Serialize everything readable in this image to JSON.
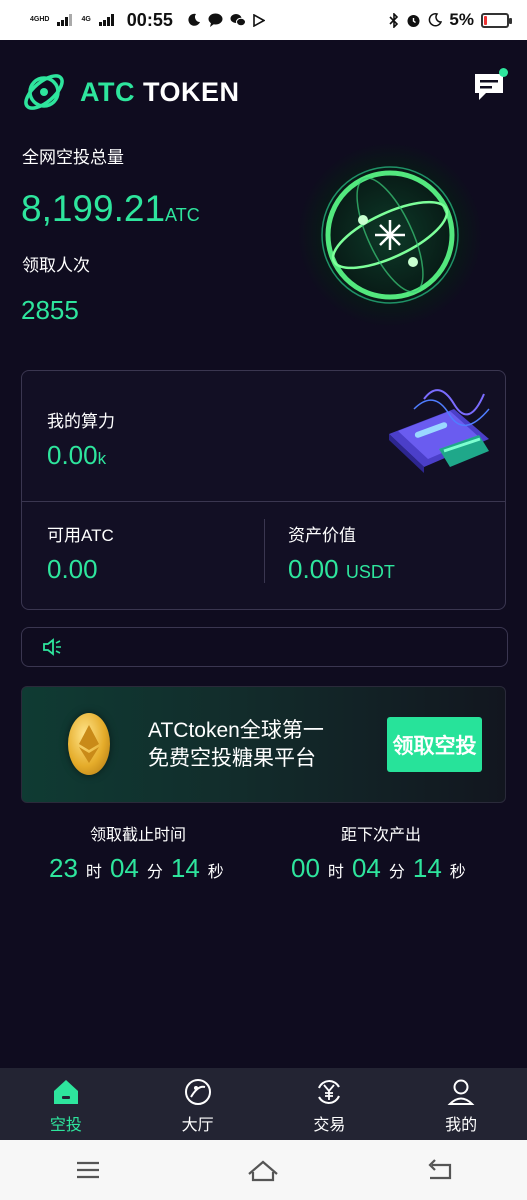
{
  "status_bar": {
    "net1": "4GHD",
    "net2": "4G",
    "time": "00:55",
    "battery": "5%"
  },
  "header": {
    "brand_accent": "ATC",
    "brand_rest": " TOKEN"
  },
  "stats": {
    "total_label": "全网空投总量",
    "total_value": "8,199.21",
    "total_unit": "ATC",
    "count_label": "领取人次",
    "count_value": "2855"
  },
  "card": {
    "power_label": "我的算力",
    "power_value": "0.00",
    "power_unit": "k",
    "available_label": "可用ATC",
    "available_value": "0.00",
    "asset_label": "资产价值",
    "asset_value": "0.00",
    "asset_unit": "USDT"
  },
  "banner": {
    "line1": "ATCtoken全球第一",
    "line2": "免费空投糖果平台",
    "button": "领取空投"
  },
  "timers": {
    "deadline_title": "领取截止时间",
    "deadline": {
      "h": "23",
      "m": "04",
      "s": "14"
    },
    "next_title": "距下次产出",
    "next": {
      "h": "00",
      "m": "04",
      "s": "14"
    },
    "unit_h": "时",
    "unit_m": "分",
    "unit_s": "秒"
  },
  "tabs": [
    {
      "label": "空投",
      "icon": "home-icon",
      "active": true
    },
    {
      "label": "大厅",
      "icon": "planet-icon",
      "active": false
    },
    {
      "label": "交易",
      "icon": "yuan-exchange-icon",
      "active": false
    },
    {
      "label": "我的",
      "icon": "user-icon",
      "active": false
    }
  ],
  "colors": {
    "accent": "#2ee59d",
    "background": "#0f0c1f",
    "tabbar": "#232433"
  }
}
